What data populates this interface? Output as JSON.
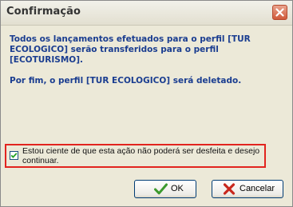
{
  "window": {
    "title": "Confirmação"
  },
  "message": {
    "line1": "Todos os lançamentos efetuados para o perfil [TUR",
    "line2": "ECOLOGICO] serão transferidos para o perfil",
    "line3": "[ECOTURISMO].",
    "line4": "Por fim, o perfil [TUR ECOLOGICO] será deletado."
  },
  "confirmation": {
    "checked": true,
    "label": "Estou ciente de que esta ação não poderá ser desfeita e desejo continuar."
  },
  "buttons": {
    "ok_label": "OK",
    "cancel_label": "Cancelar"
  },
  "icons": {
    "close": "close-icon",
    "check": "check-icon",
    "ok": "green-check-icon",
    "cancel": "red-x-icon"
  },
  "colors": {
    "message_text": "#1a3d90",
    "highlight_border": "#e2241f",
    "ok_icon": "#3c9a2e",
    "cancel_icon": "#c8281e"
  }
}
